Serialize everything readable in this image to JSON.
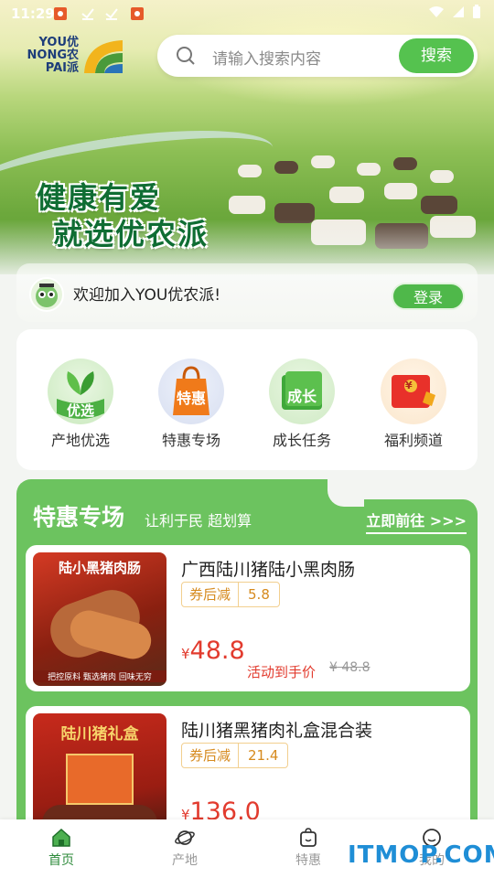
{
  "status": {
    "time": "11:29"
  },
  "logo": {
    "line1": "YOU优",
    "line2": "NONG农",
    "line3": "PAI派"
  },
  "search": {
    "placeholder": "请输入搜索内容",
    "button": "搜索"
  },
  "banner": {
    "slogan_line1": "健康有爱",
    "slogan_line2": "就选优农派"
  },
  "welcome": {
    "text": "欢迎加入YOU优农派!",
    "login": "登录"
  },
  "shortcuts": [
    {
      "label": "产地优选",
      "badge": "优选",
      "icon": "leaf-icon"
    },
    {
      "label": "特惠专场",
      "badge": "特惠",
      "icon": "bag-icon"
    },
    {
      "label": "成长任务",
      "badge": "成长",
      "icon": "growth-book-icon"
    },
    {
      "label": "福利频道",
      "badge": "¥",
      "icon": "red-envelope-icon"
    }
  ],
  "deals": {
    "title": "特惠专场",
    "subtitle": "让利于民 超划算",
    "go_label": "立即前往 >>>",
    "items": [
      {
        "name": "广西陆川猪陆小黑肉肠",
        "coupon_label": "券后减",
        "coupon_value": "5.8",
        "currency": "¥",
        "price": "48.8",
        "activity": "活动到手价",
        "original": "¥ 48.8",
        "image_title": "陆小黑猪肉肠",
        "image_tags": "把控原料  甄选猪肉  回味无穷"
      },
      {
        "name": "陆川猪黑猪肉礼盒混合装",
        "coupon_label": "券后减",
        "coupon_value": "21.4",
        "currency": "¥",
        "price": "136.0",
        "activity": "",
        "original": "",
        "image_title": "陆川猪礼盒",
        "image_tags": ""
      }
    ]
  },
  "nav": [
    {
      "label": "首页",
      "icon": "home-icon",
      "active": true
    },
    {
      "label": "产地",
      "icon": "planet-icon",
      "active": false
    },
    {
      "label": "特惠",
      "icon": "gift-bag-icon",
      "active": false
    },
    {
      "label": "我的",
      "icon": "smile-icon",
      "active": false
    }
  ],
  "watermark": "ITMOP.COM",
  "colors": {
    "brand_green": "#55c24f",
    "deal_bg": "#6cc35f",
    "price_red": "#e23b2e",
    "coupon_orange": "#d68a1e"
  }
}
